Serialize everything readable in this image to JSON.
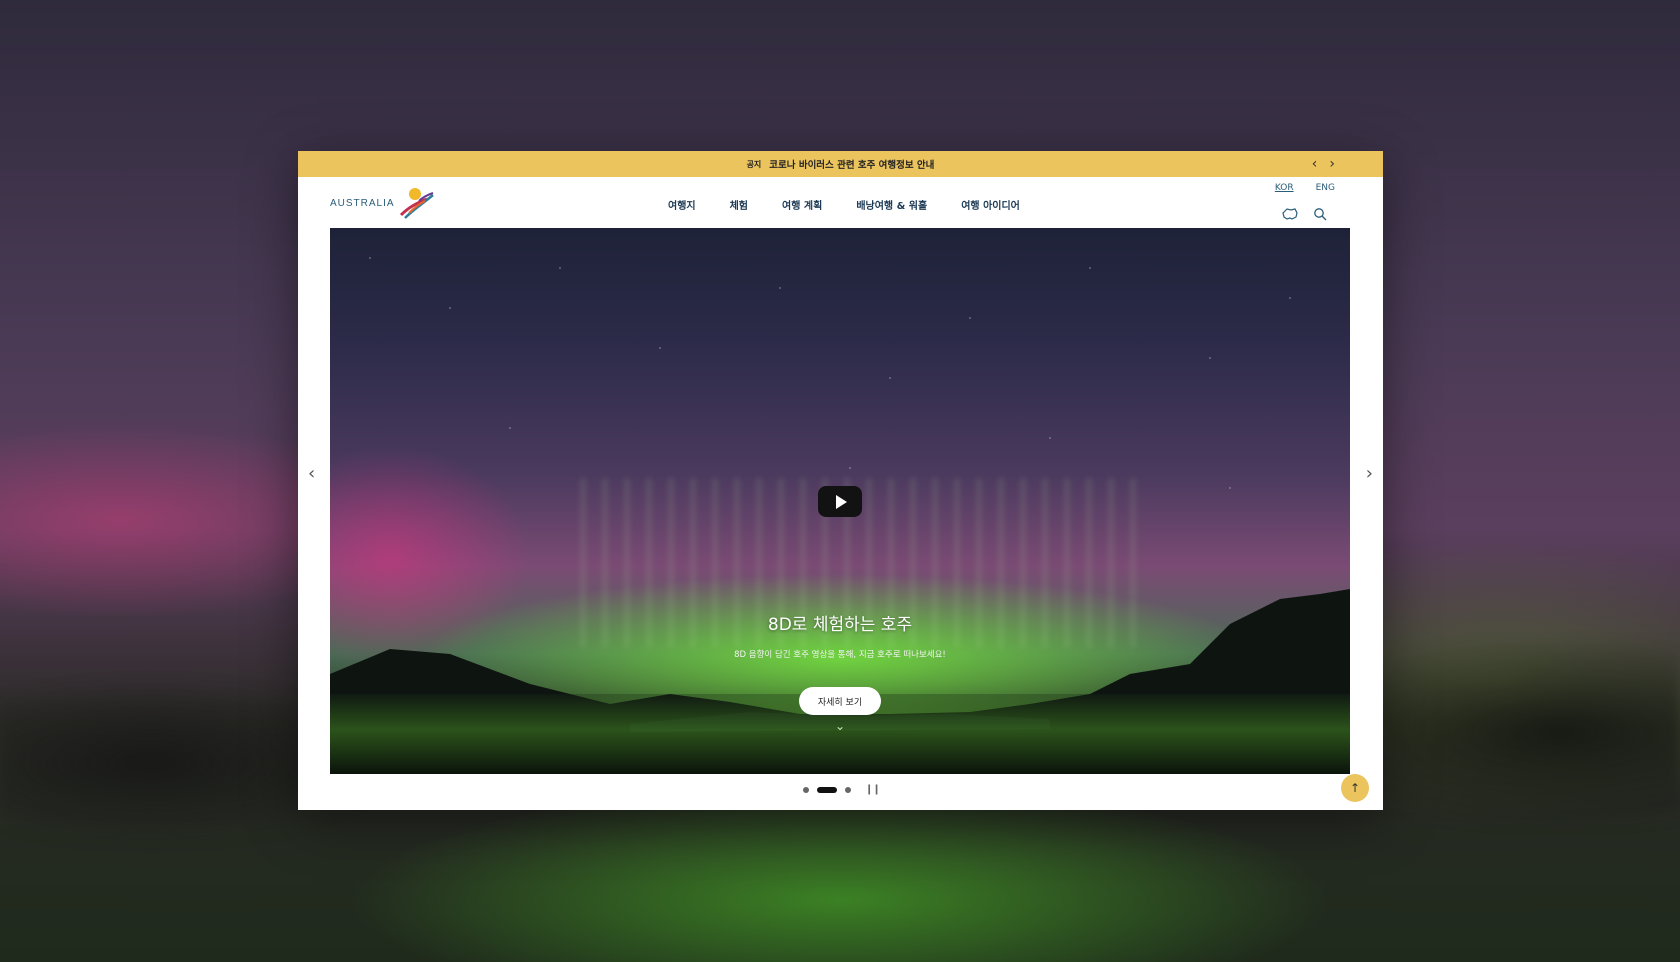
{
  "notice": {
    "tag": "공지",
    "text": "코로나 바이러스 관련 호주 여행정보 안내",
    "prev_icon": "chevron-left-icon",
    "next_icon": "chevron-right-icon"
  },
  "logo": {
    "text": "AUSTRALIA"
  },
  "nav": {
    "items": [
      {
        "label": "여행지"
      },
      {
        "label": "체험"
      },
      {
        "label": "여행 계획"
      },
      {
        "label": "배낭여행 & 워홀"
      },
      {
        "label": "여행 아이디어"
      }
    ]
  },
  "lang": {
    "kor": "KOR",
    "eng": "ENG",
    "active": "KOR"
  },
  "header_icons": [
    "map-icon",
    "search-icon"
  ],
  "hero": {
    "title": "8D로 체험하는 호주",
    "subtitle": "8D 음향이 담긴 호주 영상을 통해, 지금 호주로 떠나보세요!",
    "cta": "자세히 보기",
    "slide_count": 3,
    "active_slide": 2
  },
  "colors": {
    "accent": "#ecc45e",
    "nav_text": "#1d3a55"
  }
}
